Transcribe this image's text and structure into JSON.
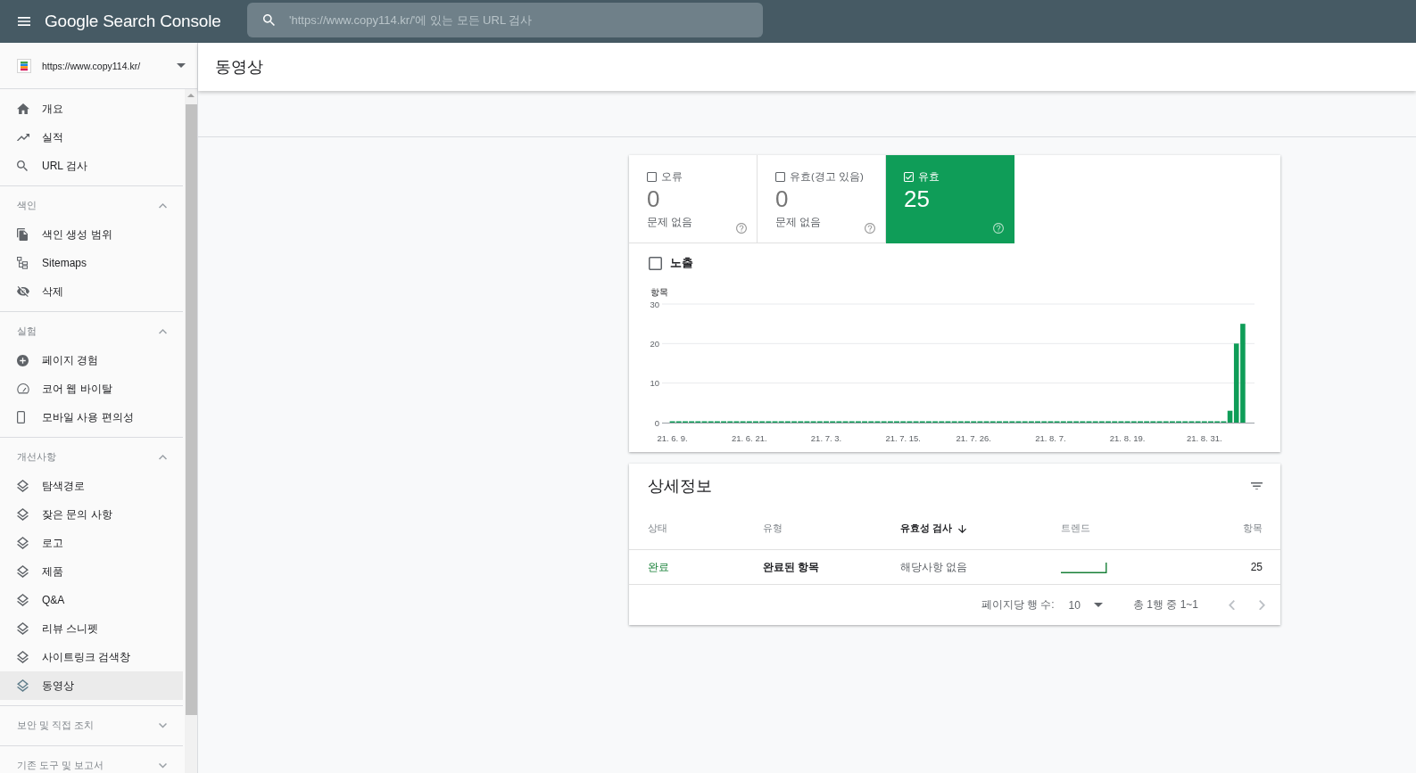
{
  "header": {
    "logo": "Google Search Console",
    "search": {
      "placeholder": "'https://www.copy114.kr/'에 있는 모든 URL 검사"
    }
  },
  "sidebar": {
    "property": "https://www.copy114.kr/",
    "groups": [
      {
        "items": [
          {
            "label": "개요",
            "selected": false
          },
          {
            "label": "실적",
            "selected": false
          },
          {
            "label": "URL 검사",
            "selected": false
          }
        ]
      },
      {
        "title": "색인",
        "expanded": true,
        "items": [
          {
            "label": "색인 생성 범위",
            "selected": false
          },
          {
            "label": "Sitemaps",
            "selected": false
          },
          {
            "label": "삭제",
            "selected": false
          }
        ]
      },
      {
        "title": "실험",
        "expanded": true,
        "items": [
          {
            "label": "페이지 경험",
            "selected": false
          },
          {
            "label": "코어 웹 바이탈",
            "selected": false
          },
          {
            "label": "모바일 사용 편의성",
            "selected": false
          }
        ]
      },
      {
        "title": "개선사항",
        "expanded": true,
        "items": [
          {
            "label": "탐색경로",
            "selected": false
          },
          {
            "label": "잦은 문의 사항",
            "selected": false
          },
          {
            "label": "로고",
            "selected": false
          },
          {
            "label": "제품",
            "selected": false
          },
          {
            "label": "Q&A",
            "selected": false
          },
          {
            "label": "리뷰 스니펫",
            "selected": false
          },
          {
            "label": "사이트링크 검색창",
            "selected": false
          },
          {
            "label": "동영상",
            "selected": true
          }
        ]
      },
      {
        "title": "보안 및 직접 조치",
        "expanded": false
      },
      {
        "title": "기존 도구 및 보고서",
        "expanded": false
      }
    ]
  },
  "page": {
    "title": "동영상"
  },
  "summary": {
    "tiles": [
      {
        "label": "오류",
        "value": "0",
        "note": "문제 없음",
        "checked": false
      },
      {
        "label": "유효(경고 있음)",
        "value": "0",
        "note": "문제 없음",
        "checked": false
      },
      {
        "label": "유효",
        "value": "25",
        "checked": true
      }
    ],
    "impressions": {
      "label": "노출",
      "checked": false
    },
    "chart_data": {
      "type": "bar",
      "ylabel": "항목",
      "categories": [
        "21. 6. 9.",
        null,
        null,
        null,
        null,
        null,
        null,
        null,
        null,
        null,
        null,
        null,
        "21. 6. 21.",
        null,
        null,
        null,
        null,
        null,
        null,
        null,
        null,
        null,
        null,
        null,
        "21. 7. 3.",
        null,
        null,
        null,
        null,
        null,
        null,
        null,
        null,
        null,
        null,
        null,
        "21. 7. 15.",
        null,
        null,
        null,
        null,
        null,
        null,
        null,
        null,
        null,
        null,
        "21. 7. 26.",
        null,
        null,
        null,
        null,
        null,
        null,
        null,
        null,
        null,
        null,
        null,
        "21. 8. 7.",
        null,
        null,
        null,
        null,
        null,
        null,
        null,
        null,
        null,
        null,
        null,
        "21. 8. 19.",
        null,
        null,
        null,
        null,
        null,
        null,
        null,
        null,
        null,
        null,
        null,
        "21. 8. 31.",
        null,
        null,
        null,
        null,
        null,
        null
      ],
      "values": [
        0,
        0,
        0,
        0,
        0,
        0,
        0,
        0,
        0,
        0,
        0,
        0,
        0,
        0,
        0,
        0,
        0,
        0,
        0,
        0,
        0,
        0,
        0,
        0,
        0,
        0,
        0,
        0,
        0,
        0,
        0,
        0,
        0,
        0,
        0,
        0,
        0,
        0,
        0,
        0,
        0,
        0,
        0,
        0,
        0,
        0,
        0,
        0,
        0,
        0,
        0,
        0,
        0,
        0,
        0,
        0,
        0,
        0,
        0,
        0,
        0,
        0,
        0,
        0,
        0,
        0,
        0,
        0,
        0,
        0,
        0,
        0,
        0,
        0,
        0,
        0,
        0,
        0,
        0,
        0,
        0,
        0,
        0,
        0,
        0,
        0,
        0,
        3,
        20,
        25
      ],
      "ylim": [
        0,
        30
      ],
      "yticks": [
        0,
        10,
        20,
        30
      ]
    }
  },
  "details": {
    "title": "상세정보",
    "columns": [
      {
        "label": "상태",
        "sorted": false
      },
      {
        "label": "유형",
        "sorted": false
      },
      {
        "label": "유효성 검사",
        "sorted": true
      },
      {
        "label": "트렌드",
        "sorted": false
      },
      {
        "label": "항목",
        "sorted": false
      }
    ],
    "rows": [
      {
        "status": "완료",
        "type": "완료된 항목",
        "validation": "해당사항 없음",
        "count": "25"
      }
    ],
    "pagination": {
      "rows_label": "페이지당 행 수:",
      "rows_per_page": "10",
      "range": "총 1행 중 1~1",
      "prev_button": {
        "disabled": true
      },
      "next_button": {
        "disabled": true
      }
    }
  }
}
